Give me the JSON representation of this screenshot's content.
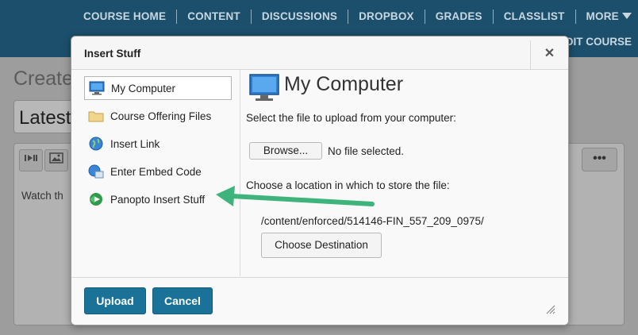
{
  "nav": {
    "items": [
      "COURSE HOME",
      "CONTENT",
      "DISCUSSIONS",
      "DROPBOX",
      "GRADES",
      "CLASSLIST",
      "MORE"
    ],
    "edit_course": "DIT COURSE"
  },
  "background": {
    "page_title": "Create",
    "content_title": "Latest",
    "editor_text": "Watch th",
    "more_button": "•••"
  },
  "dialog": {
    "title": "Insert Stuff",
    "close_glyph": "✕",
    "sources": [
      {
        "label": "My Computer",
        "icon": "computer-icon",
        "selected": true
      },
      {
        "label": "Course Offering Files",
        "icon": "folder-icon",
        "selected": false
      },
      {
        "label": "Insert Link",
        "icon": "globe-icon",
        "selected": false
      },
      {
        "label": "Enter Embed Code",
        "icon": "embed-icon",
        "selected": false
      },
      {
        "label": "Panopto Insert Stuff",
        "icon": "panopto-icon",
        "selected": false
      }
    ],
    "panel": {
      "heading": "My Computer",
      "select_prompt": "Select the file to upload from your computer:",
      "browse_label": "Browse...",
      "file_status": "No file selected.",
      "location_prompt": "Choose a location in which to store the file:",
      "path": "/content/enforced/514146-FIN_557_209_0975/",
      "choose_destination_label": "Choose Destination"
    },
    "footer": {
      "upload_label": "Upload",
      "cancel_label": "Cancel"
    }
  },
  "colors": {
    "primary_button": "#1a7299",
    "nav_background": "#1c4f6b",
    "annotation_arrow": "#3fb37c"
  }
}
